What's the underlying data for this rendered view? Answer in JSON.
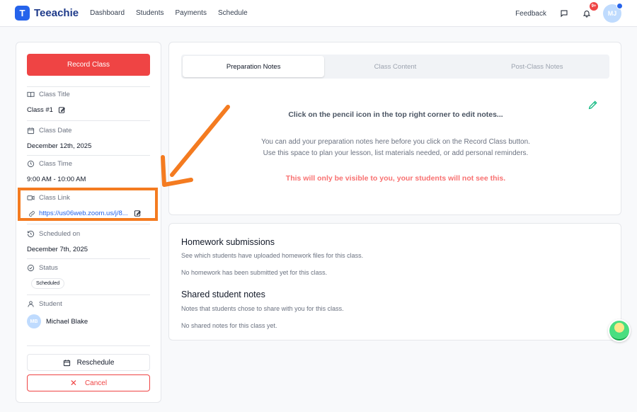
{
  "header": {
    "logo_letter": "T",
    "brand": "Teeachie",
    "nav": [
      "Dashboard",
      "Students",
      "Payments",
      "Schedule"
    ],
    "feedback": "Feedback",
    "notification_count": "9+",
    "user_initials": "MJ"
  },
  "sidebar": {
    "record_button": "Record Class",
    "class_title_label": "Class Title",
    "class_title_value": "Class #1",
    "class_date_label": "Class Date",
    "class_date_value": "December 12th, 2025",
    "class_time_label": "Class Time",
    "class_time_value": "9:00 AM - 10:00 AM",
    "class_link_label": "Class Link",
    "class_link_value": "https://us06web.zoom.us/j/8...",
    "scheduled_on_label": "Scheduled on",
    "scheduled_on_value": "December 7th, 2025",
    "status_label": "Status",
    "status_value": "Scheduled",
    "student_label": "Student",
    "student_initials": "MB",
    "student_name": "Michael Blake",
    "reschedule_button": "Reschedule",
    "cancel_button": "Cancel"
  },
  "notes": {
    "tabs": [
      "Preparation Notes",
      "Class Content",
      "Post-Class Notes"
    ],
    "active_tab": "Preparation Notes",
    "hint": "Click on the pencil icon in the top right corner to edit notes...",
    "desc_line1": "You can add your preparation notes here before you click on the Record Class button.",
    "desc_line2": "Use this space to plan your lesson, list materials needed, or add personal reminders.",
    "warning": "This will only be visible to you, your students will not see this."
  },
  "homework": {
    "title": "Homework submissions",
    "subtitle": "See which students have uploaded homework files for this class.",
    "empty": "No homework has been submitted yet for this class."
  },
  "shared_notes": {
    "title": "Shared student notes",
    "subtitle": "Notes that students chose to share with you for this class.",
    "empty": "No shared notes for this class yet."
  },
  "colors": {
    "primary": "#2563eb",
    "danger": "#ef4444",
    "highlight": "#f47b20",
    "pencil": "#10b981"
  }
}
